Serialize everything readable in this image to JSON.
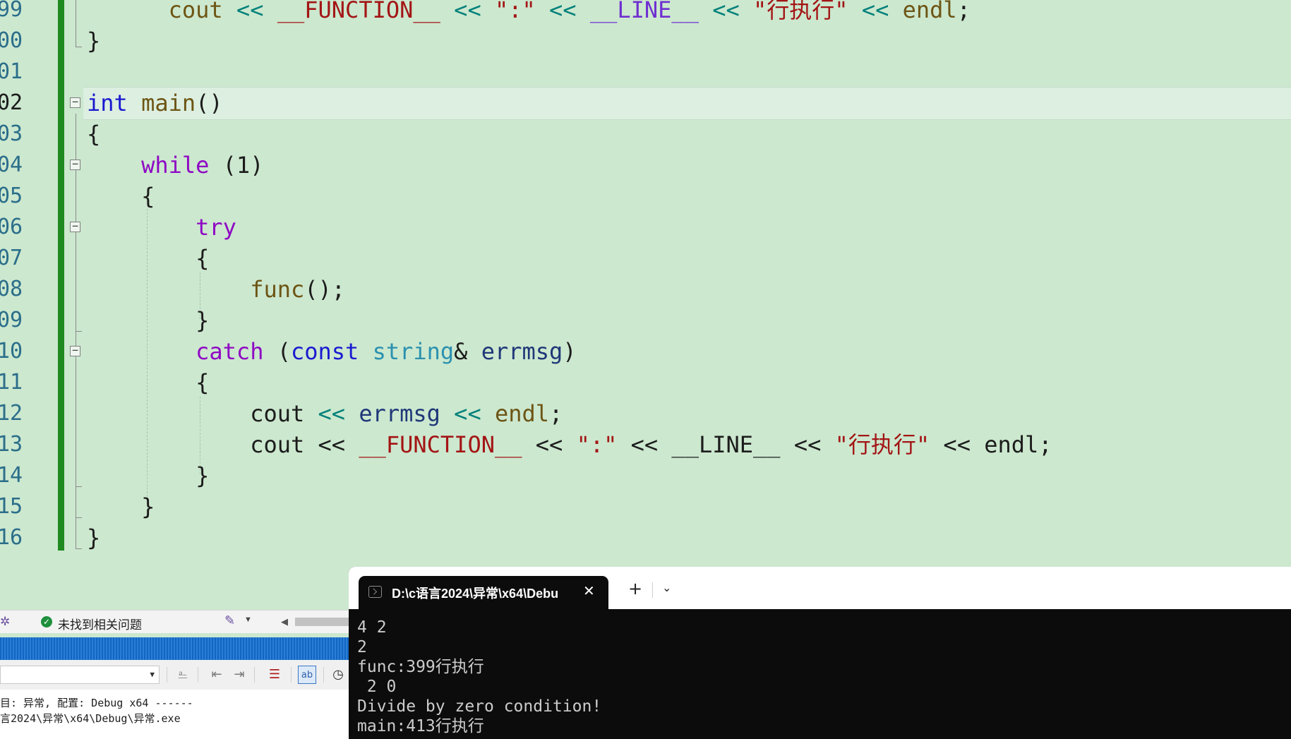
{
  "editor": {
    "line_numbers": [
      "99",
      "00",
      "01",
      "02",
      "03",
      "04",
      "05",
      "06",
      "07",
      "08",
      "09",
      "10",
      "11",
      "12",
      "13",
      "14",
      "15",
      "16"
    ],
    "active_line_number": "02",
    "tokens": {
      "cout": "cout",
      "shl": "<<",
      "FUNCTION": "__FUNCTION__",
      "colon_str": "\":\"",
      "LINE": "__LINE__",
      "exec_str": "\"行执行\"",
      "endl": "endl",
      "semicolon": ";",
      "int": "int",
      "main": "main",
      "parens": "()",
      "open_brace": "{",
      "close_brace": "}",
      "while": "while",
      "while_cond": "(1)",
      "try": "try",
      "func_call": "func",
      "call_end": "();",
      "catch": "catch",
      "lparen": "(",
      "const": "const",
      "string": "string",
      "amp": "&",
      "errmsg": "errmsg",
      "rparen": ")"
    }
  },
  "status_bar": {
    "status_text": "未找到相关问题"
  },
  "output_panel": {
    "lines": [
      "目: 异常, 配置: Debug x64 ------",
      "言2024\\异常\\x64\\Debug\\异常.exe"
    ]
  },
  "terminal": {
    "tab_title": "D:\\c语言2024\\异常\\x64\\Debu",
    "close_glyph": "✕",
    "new_tab_glyph": "+",
    "dropdown_glyph": "⌄",
    "output_lines": [
      "4 2",
      "2",
      "func:399行执行",
      " 2 0",
      "Divide by zero condition!",
      "main:413行执行"
    ]
  },
  "colors": {
    "editor_background": "#cce8cf",
    "change_bar": "#1f8a1f",
    "terminal_background": "#0c0c0c"
  }
}
